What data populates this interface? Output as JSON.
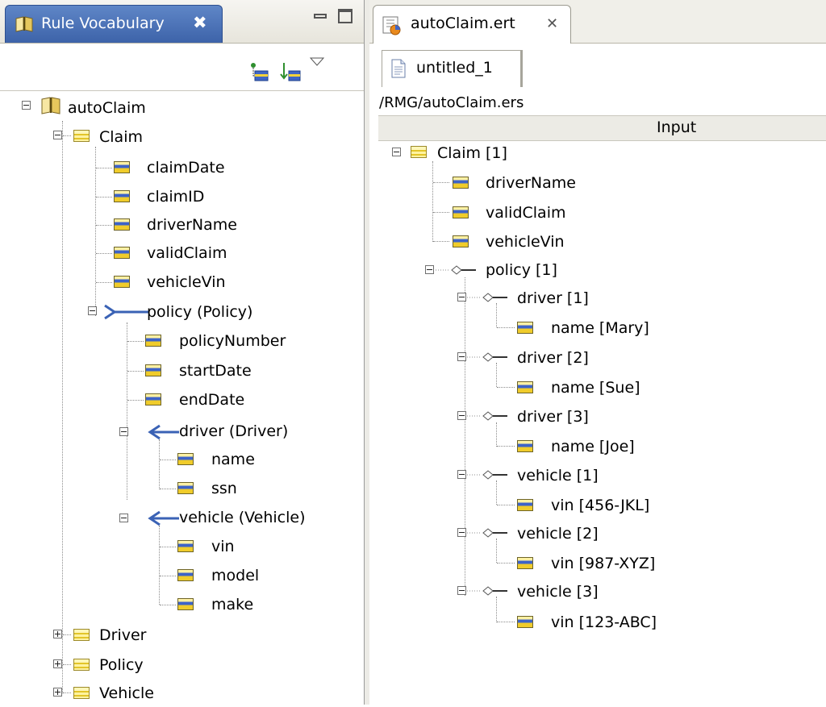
{
  "left_view": {
    "tab_title": "Rule Vocabulary",
    "tab_close": "✖",
    "toolbar": {
      "btn1_icon": "add-entity-icon",
      "btn2_icon": "sort-icon",
      "menu_icon": "view-menu-icon"
    },
    "tree": {
      "root": "autoClaim",
      "claim": "Claim",
      "claimDate": "claimDate",
      "claimID": "claimID",
      "driverName": "driverName",
      "validClaim": "validClaim",
      "vehicleVin": "vehicleVin",
      "policy": "policy (Policy)",
      "policyNumber": "policyNumber",
      "startDate": "startDate",
      "endDate": "endDate",
      "driver": "driver (Driver)",
      "name": "name",
      "ssn": "ssn",
      "vehicle": "vehicle (Vehicle)",
      "vin": "vin",
      "model": "model",
      "make": "make",
      "Driver": "Driver",
      "Policy": "Policy",
      "Vehicle": "Vehicle"
    }
  },
  "editor": {
    "tab_title": "autoClaim.ert",
    "tab_close": "✕",
    "subtab_label": "untitled_1",
    "path": "/RMG/autoClaim.ers",
    "column_header": "Input",
    "tree": {
      "claim": "Claim [1]",
      "driverName": "driverName",
      "validClaim": "validClaim",
      "vehicleVin": "vehicleVin",
      "policy": "policy [1]",
      "driver1": "driver [1]",
      "name1": "name [Mary]",
      "driver2": "driver [2]",
      "name2": "name [Sue]",
      "driver3": "driver [3]",
      "name3": "name [Joe]",
      "vehicle1": "vehicle [1]",
      "vin1": "vin [456-JKL]",
      "vehicle2": "vehicle [2]",
      "vin2": "vin [987-XYZ]",
      "vehicle3": "vehicle [3]",
      "vin3": "vin [123-ABC]"
    }
  },
  "colors": {
    "active_tab": "#4a71b6",
    "association": "#3a62b5"
  }
}
